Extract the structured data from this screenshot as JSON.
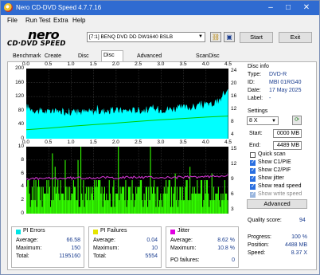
{
  "window": {
    "title": "Nero CD-DVD Speed 4.7.7.16",
    "min": "–",
    "max": "□",
    "close": "✕"
  },
  "menu": [
    "File",
    "Run Test",
    "Extra",
    "Help"
  ],
  "logo": {
    "line1": "nero",
    "line2": "CD·DVD SPEED"
  },
  "toolbar": {
    "drive": "[7:1]   BENQ DVD DD DW1640 BSLB",
    "start": "Start",
    "exit": "Exit",
    "icons": [
      "chain-icon",
      "save-icon"
    ]
  },
  "tabs": [
    "Benchmark",
    "Create Disc",
    "Disc Info",
    "Disc Quality",
    "Advanced Disc Quality",
    "ScanDisc"
  ],
  "active_tab": "Disc Quality",
  "disc_info": {
    "header": "Disc info",
    "type_label": "Type:",
    "type_value": "DVD-R",
    "id_label": "ID:",
    "id_value": "MBI 01RG40",
    "date_label": "Date:",
    "date_value": "17 May 2025",
    "label_label": "Label:",
    "label_value": "-"
  },
  "settings": {
    "header": "Settings",
    "speed": "8 X",
    "start_label": "Start:",
    "start_value": "0000 MB",
    "end_label": "End:",
    "end_value": "4489 MB",
    "checks": [
      {
        "label": "Quick scan",
        "on": false,
        "disabled": false
      },
      {
        "label": "Show C1/PIE",
        "on": true,
        "disabled": false
      },
      {
        "label": "Show C2/PIF",
        "on": true,
        "disabled": false
      },
      {
        "label": "Show jitter",
        "on": true,
        "disabled": false
      },
      {
        "label": "Show read speed",
        "on": true,
        "disabled": false
      },
      {
        "label": "Show write speed",
        "on": true,
        "disabled": true
      }
    ],
    "advanced": "Advanced"
  },
  "quality": {
    "label": "Quality score:",
    "value": "94"
  },
  "progress": {
    "progress_label": "Progress:",
    "progress_value": "100 %",
    "position_label": "Position:",
    "position_value": "4488 MB",
    "speed_label": "Speed:",
    "speed_value": "8.37 X"
  },
  "pi_errors": {
    "header": "PI Errors",
    "color": "#00e5e5",
    "avg_label": "Average:",
    "avg": "66.58",
    "max_label": "Maximum:",
    "max": "150",
    "total_label": "Total:",
    "total": "1195160"
  },
  "pi_failures": {
    "header": "PI Failures",
    "color": "#e5e500",
    "avg_label": "Average:",
    "avg": "0.04",
    "max_label": "Maximum:",
    "max": "10",
    "total_label": "Total:",
    "total": "5554"
  },
  "jitter": {
    "header": "Jitter",
    "color": "#e000e0",
    "avg_label": "Average:",
    "avg": "8.62 %",
    "max_label": "Maximum:",
    "max": "10.8 %",
    "pof_label": "PO failures:",
    "pof": "0"
  },
  "chart_data": [
    {
      "type": "area",
      "x_ticks": [
        "0.0",
        "0.5",
        "1.0",
        "1.5",
        "2.0",
        "2.5",
        "3.0",
        "3.5",
        "4.0",
        "4.5"
      ],
      "y_left_ticks": [
        "200",
        "160",
        "120",
        "80",
        "40",
        "0"
      ],
      "y_right_ticks": [
        "24",
        "20",
        "16",
        "12",
        "8",
        "4"
      ],
      "xlim": [
        0,
        4.5
      ],
      "ylim_left": [
        0,
        200
      ],
      "ylim_right": [
        0,
        26
      ],
      "series": [
        {
          "kind": "pi_errors",
          "color": "#00ffff",
          "x": [
            0.0,
            0.25,
            0.5,
            0.75,
            1.0,
            1.25,
            1.5,
            1.75,
            2.0,
            2.25,
            2.5,
            2.75,
            3.0,
            3.25,
            3.5,
            3.75,
            4.0,
            4.2,
            4.3,
            4.4,
            4.49
          ],
          "values": [
            90,
            78,
            76,
            77,
            76,
            76,
            77,
            78,
            80,
            80,
            81,
            82,
            83,
            85,
            88,
            90,
            95,
            100,
            108,
            118,
            150
          ]
        },
        {
          "kind": "read_speed",
          "color": "#00cc00",
          "x": [
            0.0,
            0.5,
            1.0,
            1.5,
            2.0,
            2.5,
            3.0,
            3.5,
            4.0,
            4.49
          ],
          "values": [
            3.3,
            3.9,
            4.6,
            5.2,
            5.8,
            6.4,
            7.0,
            7.5,
            8.0,
            8.4
          ]
        }
      ]
    },
    {
      "type": "bar",
      "x_ticks": [
        "0.0",
        "0.5",
        "1.0",
        "1.5",
        "2.0",
        "2.5",
        "3.0",
        "3.5",
        "4.0",
        "4.5"
      ],
      "y_left_ticks": [
        "10",
        "8",
        "6",
        "4",
        "2",
        "0"
      ],
      "y_right_ticks": [
        "15",
        "12",
        "9",
        "6",
        "3"
      ],
      "xlim": [
        0,
        4.5
      ],
      "ylim_left": [
        0,
        10
      ],
      "ylim_right": [
        0,
        16
      ],
      "series": [
        {
          "kind": "pi_failures",
          "color": "#33ff00",
          "typical": [
            1,
            5
          ],
          "max": 10
        },
        {
          "kind": "jitter",
          "color": "#cc33cc",
          "x": [
            0.0,
            0.5,
            1.0,
            1.5,
            2.0,
            2.5,
            3.0,
            3.5,
            4.0,
            4.49
          ],
          "values": [
            8.3,
            8.4,
            8.5,
            8.6,
            8.6,
            8.7,
            8.6,
            8.7,
            8.8,
            9.2
          ]
        }
      ]
    }
  ]
}
